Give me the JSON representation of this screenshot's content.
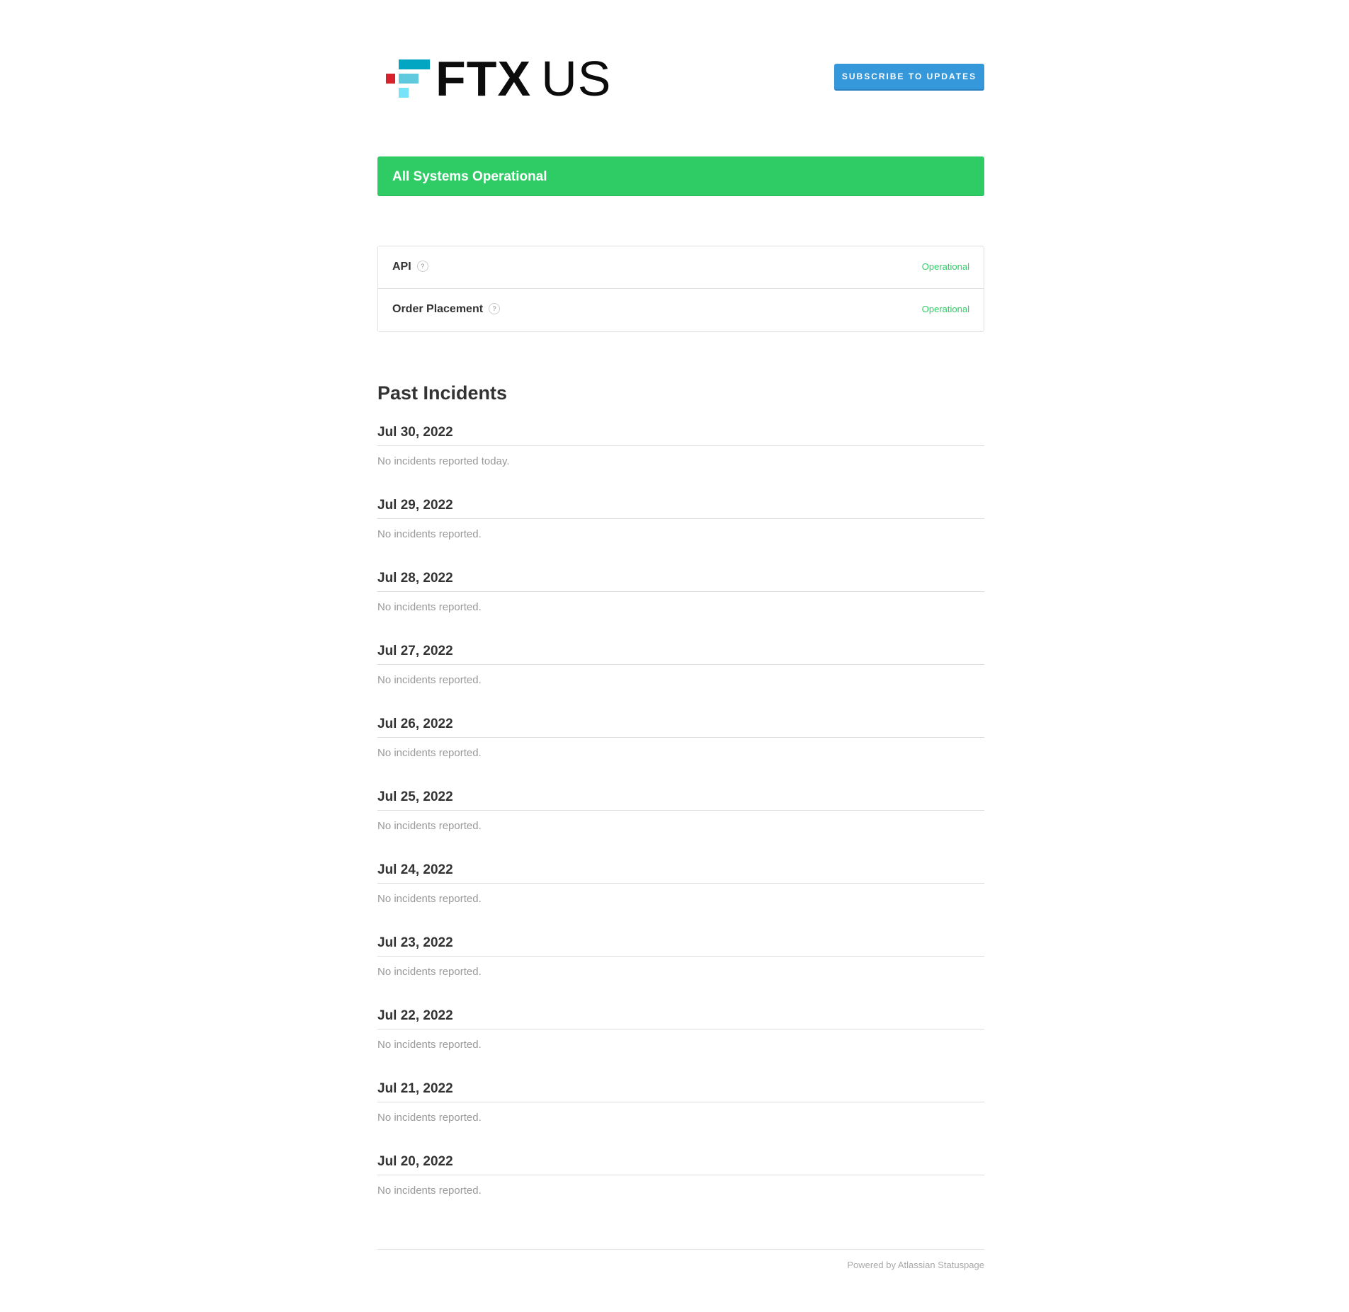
{
  "header": {
    "logo_text_bold": "FTX",
    "logo_text_light": "US",
    "subscribe_label": "SUBSCRIBE TO UPDATES"
  },
  "status": {
    "banner_text": "All Systems Operational",
    "color": "#2fcc66"
  },
  "components": [
    {
      "name": "API",
      "help_icon": "?",
      "status": "Operational"
    },
    {
      "name": "Order Placement",
      "help_icon": "?",
      "status": "Operational"
    }
  ],
  "past_incidents": {
    "title": "Past Incidents",
    "days": [
      {
        "date": "Jul 30, 2022",
        "message": "No incidents reported today."
      },
      {
        "date": "Jul 29, 2022",
        "message": "No incidents reported."
      },
      {
        "date": "Jul 28, 2022",
        "message": "No incidents reported."
      },
      {
        "date": "Jul 27, 2022",
        "message": "No incidents reported."
      },
      {
        "date": "Jul 26, 2022",
        "message": "No incidents reported."
      },
      {
        "date": "Jul 25, 2022",
        "message": "No incidents reported."
      },
      {
        "date": "Jul 24, 2022",
        "message": "No incidents reported."
      },
      {
        "date": "Jul 23, 2022",
        "message": "No incidents reported."
      },
      {
        "date": "Jul 22, 2022",
        "message": "No incidents reported."
      },
      {
        "date": "Jul 21, 2022",
        "message": "No incidents reported."
      },
      {
        "date": "Jul 20, 2022",
        "message": "No incidents reported."
      }
    ]
  },
  "footer": {
    "powered_by": "Powered by Atlassian Statuspage"
  },
  "colors": {
    "accent_blue": "#3598db",
    "operational_green": "#2fcc66",
    "logo_red": "#d8222b",
    "logo_cyan": "#02a6c2"
  }
}
